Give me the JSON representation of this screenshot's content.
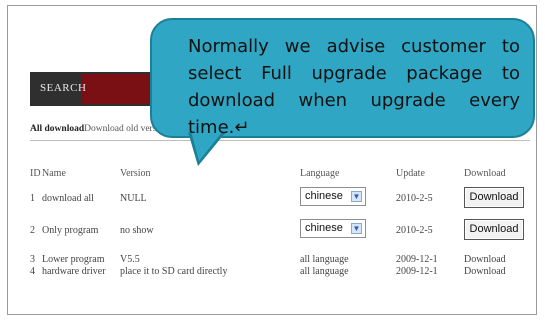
{
  "search": {
    "label": "SEARCH"
  },
  "tabs": {
    "active": "All download",
    "other": "Download old version"
  },
  "callout": {
    "text": "Normally we advise customer to select Full upgrade package to download when upgrade every time.↵"
  },
  "table": {
    "headers": {
      "id": "ID",
      "name": "Name",
      "version": "Version",
      "language": "Language",
      "update": "Update",
      "download": "Download"
    },
    "rows": [
      {
        "id": "1",
        "name": "download all",
        "version": "NULL",
        "language": "chinese",
        "update": "2010-2-5",
        "download": "Download",
        "language_is_select": true,
        "download_is_button": true
      },
      {
        "id": "2",
        "name": "Only program",
        "version": "no show",
        "language": "chinese",
        "update": "2010-2-5",
        "download": "Download",
        "language_is_select": true,
        "download_is_button": true
      },
      {
        "id": "3",
        "name": "Lower program",
        "version": "V5.5",
        "language": "all language",
        "update": "2009-12-1",
        "download": "Download"
      },
      {
        "id": "4",
        "name": "hardware driver",
        "version": "place it to SD card directly",
        "language": "all language",
        "update": "2009-12-1",
        "download": "Download"
      }
    ]
  },
  "icons": {
    "select_chevron": "chevron-down-icon"
  }
}
